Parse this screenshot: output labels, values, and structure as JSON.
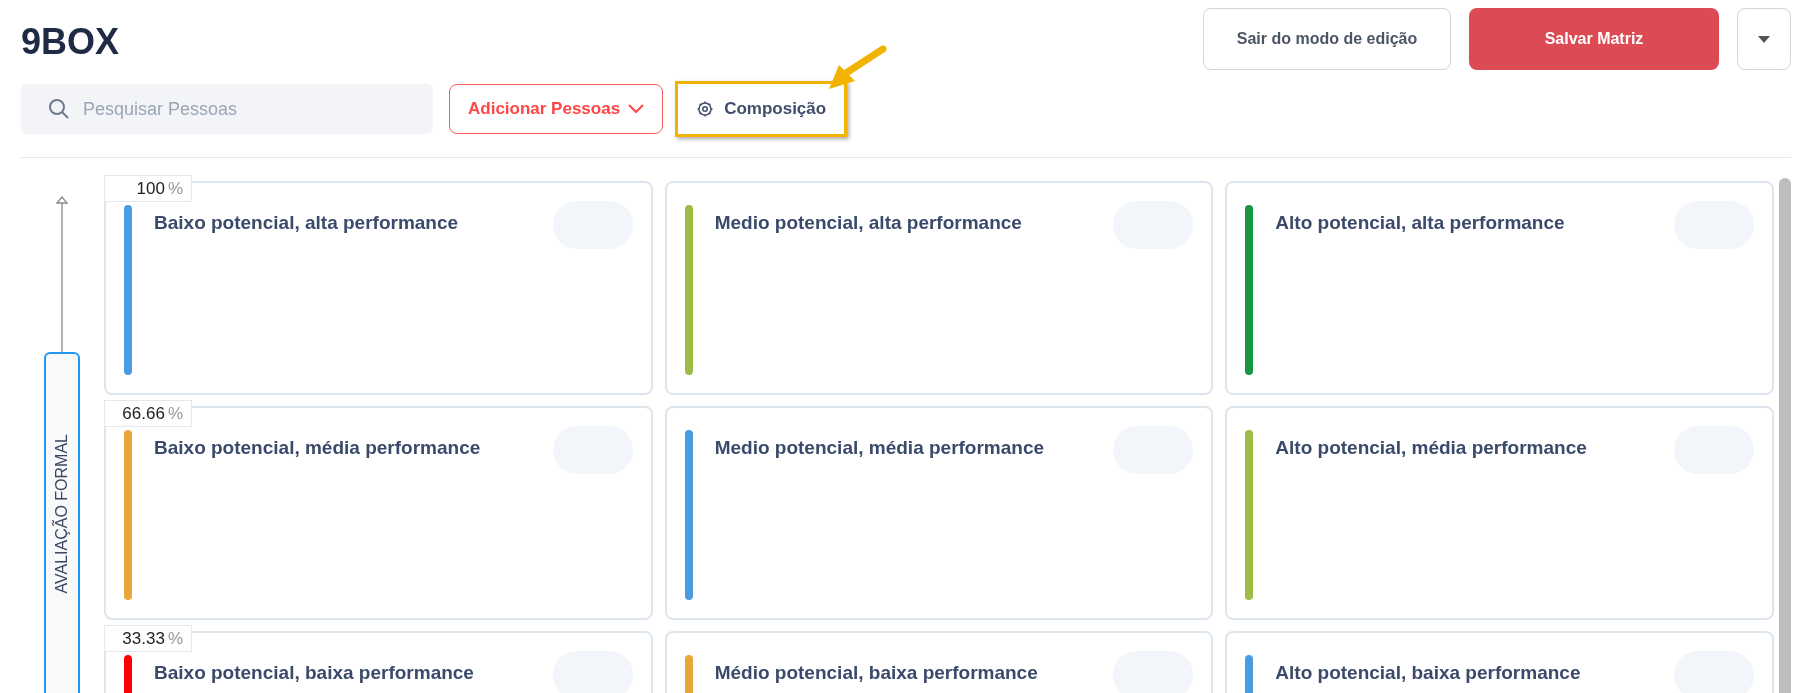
{
  "title": "9BOX",
  "header_buttons": [
    {
      "label": "Sair do modo de edição",
      "kind": "outline"
    },
    {
      "label": "Salvar Matriz",
      "kind": "primary"
    },
    {
      "kind": "caret"
    }
  ],
  "search": {
    "placeholder": "Pesquisar Pessoas"
  },
  "toolbar": {
    "add_people": "Adicionar Pessoas",
    "composition": "Composição",
    "composition_highlighted": true
  },
  "y_axis": {
    "label": "AVALIAÇÃO FORMAL"
  },
  "rows": [
    {
      "percent": "100",
      "unit": "%",
      "cells": [
        {
          "title": "Baixo potencial, alta performance",
          "color": "#4a9be0"
        },
        {
          "title": "Medio potencial, alta performance",
          "color": "#9bbd45"
        },
        {
          "title": "Alto potencial, alta performance",
          "color": "#17973f"
        }
      ]
    },
    {
      "percent": "66.66",
      "unit": "%",
      "cells": [
        {
          "title": "Baixo potencial, média performance",
          "color": "#e9a63a"
        },
        {
          "title": "Medio potencial, média performance",
          "color": "#4a9be0"
        },
        {
          "title": "Alto potencial, média performance",
          "color": "#9bbd45"
        }
      ]
    },
    {
      "percent": "33.33",
      "unit": "%",
      "cells": [
        {
          "title": "Baixo potencial, baixa performance",
          "color": "#ff0000"
        },
        {
          "title": "Médio potencial, baixa performance",
          "color": "#e9a63a"
        },
        {
          "title": "Alto potencial, baixa performance",
          "color": "#4a9be0"
        }
      ]
    }
  ]
}
